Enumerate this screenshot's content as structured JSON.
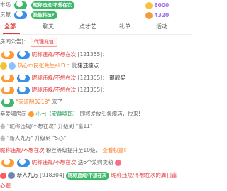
{
  "top_list": [
    {
      "frag": "本场",
      "badge": "",
      "name": "昵称违规/不想在次",
      "coins": "6000"
    },
    {
      "frag": "贡献",
      "badge": "",
      "name": "技能科技z",
      "coins": "4320"
    }
  ],
  "tabs": [
    "全部",
    "聊天",
    "点才艺",
    "礼单",
    "活动"
  ],
  "announcement": {
    "prefix": "房间公告]：",
    "badge": "代理充值"
  },
  "messages": [
    {
      "id": "m1",
      "num": "",
      "name": "昵称违规/不想在次",
      "id_text": "[121355]："
    },
    {
      "id": "m2",
      "name": "热心市民张先生aLD",
      "text": "：比猪还瘦点"
    },
    {
      "id": "m3",
      "name": "昵称违规/不想在次",
      "id_text": "[121355]：",
      "text": "那靓买"
    },
    {
      "id": "m4",
      "num": "",
      "name": "昵称违规/不想在次",
      "id_text": "[121355]："
    },
    {
      "id": "m5",
      "welcome": "\"天道酬0218\"",
      "text": "来了"
    },
    {
      "id": "m6",
      "text1": "亲爱哪房间",
      "user": "小七（安静嗑耶）",
      "text2": "即将发放头条爆店，快来!"
    },
    {
      "id": "m7",
      "text1": "喜 \"昵称违规/不想在次\" 升级到 \"富11\""
    },
    {
      "id": "m8",
      "text1": "喜 \"新人九万\" 升级到 \"5心\""
    },
    {
      "id": "m9",
      "name": "昵称违规/不想在次",
      "text": "粉丝等级提升至10级，",
      "highlight": "查看权益!"
    },
    {
      "id": "m10",
      "name": "昵称违规/不想在次",
      "text": "送6个菜购卖萌"
    },
    {
      "id": "m11",
      "name": "新人九万",
      "id_text": "[918304]",
      "text": "昵称违规/不想在次",
      "tail": "昵称违规/不想在次的周刊富"
    },
    {
      "id": "m12",
      "text1": "心题"
    }
  ],
  "colors": {
    "accent": "#e23a3a",
    "green_badge": "#3cb86a",
    "blue_badge": "#3b8fe6",
    "orange_badge": "#ff9b32"
  }
}
